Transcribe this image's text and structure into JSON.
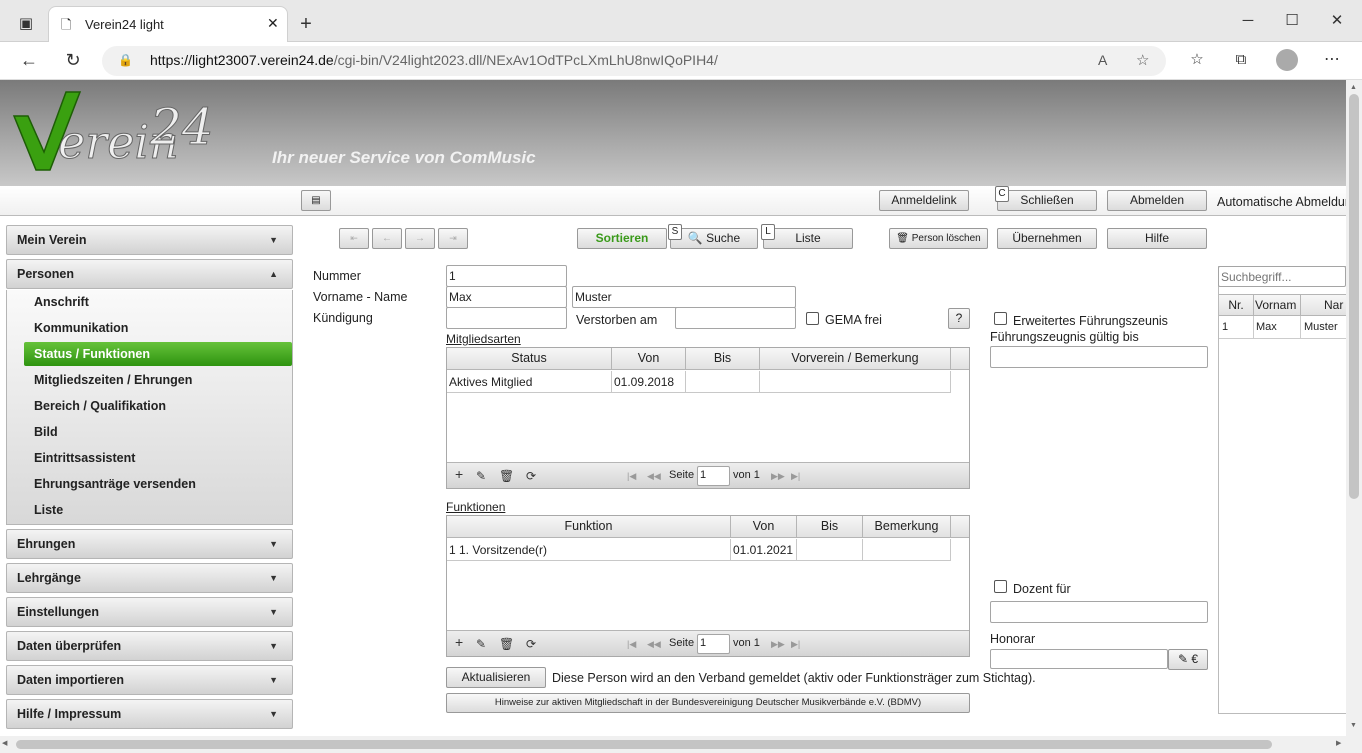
{
  "browser": {
    "tab_title": "Verein24 light",
    "url_host": "https://light23007.verein24.de",
    "url_path": "/cgi-bin/V24light2023.dll/NExAv1OdTPcLXmLhU8nwIQoPIH4/"
  },
  "banner": {
    "logo_text": "Verein 24",
    "tagline": "Ihr neuer Service von ComMusic"
  },
  "toprow": {
    "anmeldelink": "Anmeldelink",
    "schliessen": "Schließen",
    "schliessen_key": "C",
    "abmelden": "Abmelden",
    "auto_logout": "Automatische Abmeldung"
  },
  "sidebar": {
    "mein_verein": "Mein Verein",
    "personen": "Personen",
    "items": [
      "Anschrift",
      "Kommunikation",
      "Status / Funktionen",
      "Mitgliedszeiten / Ehrungen",
      "Bereich / Qualifikation",
      "Bild",
      "Eintrittsassistent",
      "Ehrungsanträge versenden",
      "Liste"
    ],
    "bottom": [
      "Ehrungen",
      "Lehrgänge",
      "Einstellungen",
      "Daten überprüfen",
      "Daten importieren",
      "Hilfe / Impressum"
    ]
  },
  "toolbar": {
    "sortieren": "Sortieren",
    "suche": "Suche",
    "suche_key": "S",
    "liste": "Liste",
    "liste_key": "L",
    "person_loeschen": "Person löschen",
    "uebernehmen": "Übernehmen",
    "hilfe": "Hilfe"
  },
  "form": {
    "nummer_label": "Nummer",
    "nummer": "1",
    "name_label": "Vorname - Name",
    "vorname": "Max",
    "nachname": "Muster",
    "kuendigung_label": "Kündigung",
    "kuendigung": "",
    "verstorben_label": "Verstorben am",
    "verstorben": "",
    "gema_label": "GEMA frei",
    "help_q": "?",
    "fz_label": "Erweitertes Führungszeunis",
    "fz_gueltig_label": "Führungszeugnis gültig bis",
    "fz_gueltig": "",
    "dozent_label": "Dozent für",
    "dozent": "",
    "honorar_label": "Honorar",
    "honorar": "",
    "honorar_btn": "€"
  },
  "mitgliedsarten": {
    "title": "Mitgliedsarten",
    "headers": [
      "Status",
      "Von",
      "Bis",
      "Vorverein / Bemerkung"
    ],
    "rows": [
      [
        "Aktives Mitglied",
        "01.09.2018",
        "",
        ""
      ]
    ],
    "seite_label": "Seite",
    "seite": "1",
    "von_label": "von 1"
  },
  "funktionen": {
    "title": "Funktionen",
    "headers": [
      "Funktion",
      "Von",
      "Bis",
      "Bemerkung"
    ],
    "rows": [
      [
        "1 1. Vorsitzende(r)",
        "01.01.2021",
        "",
        ""
      ]
    ],
    "seite_label": "Seite",
    "seite": "1",
    "von_label": "von 1"
  },
  "bottom": {
    "aktualisieren": "Aktualisieren",
    "verband_note": "Diese Person wird an den Verband gemeldet (aktiv oder Funktionsträger zum Stichtag).",
    "bdmv_btn": "Hinweise zur aktiven Mitgliedschaft in der Bundesvereinigung Deutscher Musikverbände e.V. (BDMV)"
  },
  "rightlist": {
    "search_placeholder": "Suchbegriff...",
    "headers": [
      "Nr.",
      "Vornam",
      "Nar"
    ],
    "rows": [
      [
        "1",
        "Max",
        "Muster"
      ]
    ]
  }
}
